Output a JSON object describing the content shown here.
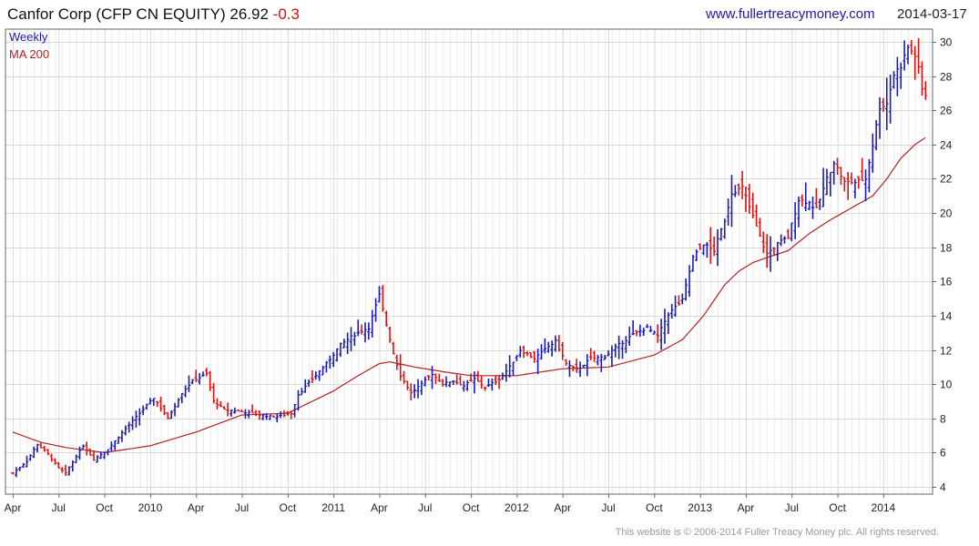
{
  "header": {
    "name": "Canfor Corp",
    "ticker": "(CFP CN EQUITY)",
    "price": "26.92",
    "change": "-0.3",
    "website": "www.fullertreacymoney.com",
    "date": "2014-03-17"
  },
  "legend": {
    "weekly": "Weekly",
    "ma": "MA 200"
  },
  "footer": "This website is © 2006-2014 Fuller Treacy Money plc. All rights reserved.",
  "colors": {
    "up": "#1a1ab8",
    "down": "#e01010",
    "ma": "#b22222",
    "grid": "#d9d9d9",
    "title_change": "#d01010",
    "website": "#1a1aa6"
  },
  "chart_data": {
    "type": "line",
    "title": "Canfor Corp (CFP CN EQUITY) 26.92 -0.3",
    "xlabel": "",
    "ylabel": "",
    "ylim": [
      4,
      30
    ],
    "y_ticks": [
      4,
      6,
      8,
      10,
      12,
      14,
      16,
      18,
      20,
      22,
      24,
      26,
      28,
      30
    ],
    "y_axis_side": "right",
    "x_ticks": [
      "Apr",
      "Jul",
      "Oct",
      "2010",
      "Apr",
      "Jul",
      "Oct",
      "2011",
      "Apr",
      "Jul",
      "Oct",
      "2012",
      "Apr",
      "Jul",
      "Oct",
      "2013",
      "Apr",
      "Jul",
      "Oct",
      "2014"
    ],
    "x_tick_week": [
      0,
      13,
      26,
      39,
      52,
      65,
      78,
      91,
      104,
      117,
      130,
      143,
      156,
      169,
      182,
      195,
      208,
      221,
      234,
      247
    ],
    "week_count": 260,
    "grid": true,
    "legend_position": "top-left",
    "series": [
      {
        "name": "Weekly",
        "style": "price bars",
        "anchors": [
          [
            0,
            4.8
          ],
          [
            4,
            5.5
          ],
          [
            7,
            6.5
          ],
          [
            10,
            5.9
          ],
          [
            13,
            5.1
          ],
          [
            15,
            4.8
          ],
          [
            18,
            5.8
          ],
          [
            20,
            6.4
          ],
          [
            23,
            5.6
          ],
          [
            27,
            6.2
          ],
          [
            32,
            7.4
          ],
          [
            36,
            8.3
          ],
          [
            40,
            9.2
          ],
          [
            44,
            8.0
          ],
          [
            48,
            9.5
          ],
          [
            51,
            10.2
          ],
          [
            55,
            10.6
          ],
          [
            57,
            9.0
          ],
          [
            60,
            8.5
          ],
          [
            65,
            8.4
          ],
          [
            70,
            8.2
          ],
          [
            75,
            8.1
          ],
          [
            79,
            8.3
          ],
          [
            81,
            9.4
          ],
          [
            85,
            10.3
          ],
          [
            89,
            11.2
          ],
          [
            93,
            12.3
          ],
          [
            97,
            12.9
          ],
          [
            101,
            13.3
          ],
          [
            104,
            15.2
          ],
          [
            106,
            13.5
          ],
          [
            108,
            11.8
          ],
          [
            110,
            10.5
          ],
          [
            113,
            9.5
          ],
          [
            116,
            10.0
          ],
          [
            119,
            10.6
          ],
          [
            122,
            10.0
          ],
          [
            125,
            10.2
          ],
          [
            128,
            9.9
          ],
          [
            131,
            10.3
          ],
          [
            134,
            9.8
          ],
          [
            138,
            10.3
          ],
          [
            141,
            11.0
          ],
          [
            144,
            12.0
          ],
          [
            148,
            11.5
          ],
          [
            152,
            12.2
          ],
          [
            154,
            12.5
          ],
          [
            157,
            11.2
          ],
          [
            160,
            10.8
          ],
          [
            164,
            11.5
          ],
          [
            168,
            11.6
          ],
          [
            172,
            12.3
          ],
          [
            176,
            12.9
          ],
          [
            180,
            13.3
          ],
          [
            183,
            12.8
          ],
          [
            186,
            14.1
          ],
          [
            190,
            14.9
          ],
          [
            193,
            17.4
          ],
          [
            196,
            18.2
          ],
          [
            199,
            17.8
          ],
          [
            202,
            19.6
          ],
          [
            204,
            21.2
          ],
          [
            207,
            21.5
          ],
          [
            210,
            19.8
          ],
          [
            212,
            18.6
          ],
          [
            214,
            17.6
          ],
          [
            217,
            18.2
          ],
          [
            220,
            18.6
          ],
          [
            223,
            20.8
          ],
          [
            226,
            20.6
          ],
          [
            228,
            20.2
          ],
          [
            231,
            22.0
          ],
          [
            233,
            23.0
          ],
          [
            236,
            21.8
          ],
          [
            239,
            21.8
          ],
          [
            242,
            22.0
          ],
          [
            244,
            24.0
          ],
          [
            246,
            26.2
          ],
          [
            248,
            26.4
          ],
          [
            250,
            28.1
          ],
          [
            252,
            28.6
          ],
          [
            254,
            29.7
          ],
          [
            256,
            29.2
          ],
          [
            257,
            28.4
          ],
          [
            258,
            27.2
          ],
          [
            259,
            26.9
          ]
        ]
      },
      {
        "name": "MA 200",
        "style": "line",
        "anchors": [
          [
            0,
            7.2
          ],
          [
            8,
            6.6
          ],
          [
            15,
            6.3
          ],
          [
            26,
            6.0
          ],
          [
            39,
            6.4
          ],
          [
            52,
            7.2
          ],
          [
            65,
            8.2
          ],
          [
            78,
            8.3
          ],
          [
            91,
            9.6
          ],
          [
            98,
            10.5
          ],
          [
            104,
            11.2
          ],
          [
            107,
            11.3
          ],
          [
            114,
            11.0
          ],
          [
            123,
            10.7
          ],
          [
            130,
            10.5
          ],
          [
            143,
            10.5
          ],
          [
            156,
            10.9
          ],
          [
            169,
            11.0
          ],
          [
            182,
            11.7
          ],
          [
            190,
            12.6
          ],
          [
            196,
            14.0
          ],
          [
            202,
            15.8
          ],
          [
            206,
            16.6
          ],
          [
            210,
            17.1
          ],
          [
            214,
            17.4
          ],
          [
            220,
            17.8
          ],
          [
            226,
            18.8
          ],
          [
            232,
            19.6
          ],
          [
            238,
            20.3
          ],
          [
            244,
            21.0
          ],
          [
            248,
            22.0
          ],
          [
            252,
            23.2
          ],
          [
            256,
            24.0
          ],
          [
            259,
            24.4
          ]
        ]
      }
    ]
  }
}
